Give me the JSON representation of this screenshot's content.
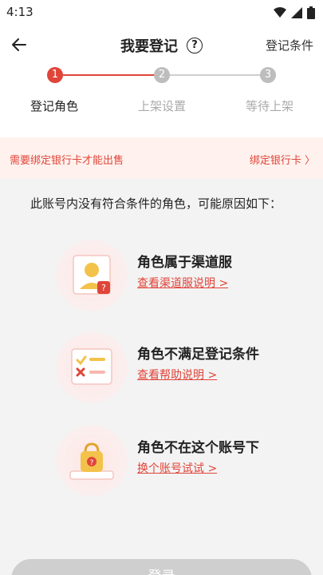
{
  "status": {
    "time": "4:13"
  },
  "header": {
    "title": "我要登记",
    "help": "?",
    "right_link": "登记条件"
  },
  "steps": [
    {
      "num": "1",
      "label": "登记角色"
    },
    {
      "num": "2",
      "label": "上架设置"
    },
    {
      "num": "3",
      "label": "等待上架"
    }
  ],
  "notice": {
    "text": "需要绑定银行卡才能出售",
    "link": "绑定银行卡 〉"
  },
  "intro": "此账号内没有符合条件的角色，可能原因如下：",
  "reasons": [
    {
      "title": "角色属于渠道服",
      "link": "查看渠道服说明 >"
    },
    {
      "title": "角色不满足登记条件",
      "link": "查看帮助说明 >"
    },
    {
      "title": "角色不在这个账号下",
      "link": "换个账号试试 >"
    }
  ],
  "bottom_button": "登录",
  "colors": {
    "accent": "#e0453a",
    "inactive": "#bdbdbd",
    "notice_bg": "#fff2ee"
  }
}
